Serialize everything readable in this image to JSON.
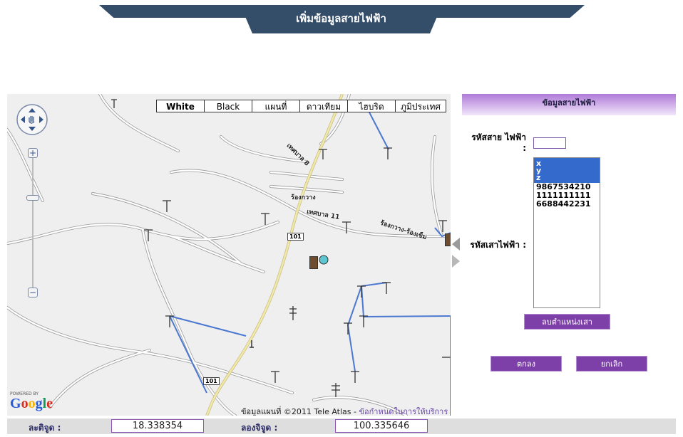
{
  "header": {
    "title": "เพิ่มข้อมูลสายไฟฟ้า"
  },
  "map": {
    "map_types": [
      "White",
      "Black",
      "แผนที่",
      "ดาวเทียม",
      "ไฮบริด",
      "ภูมิประเทศ"
    ],
    "active_map_type": "White",
    "powered_by": "POWERED BY",
    "google_logo": "Google",
    "copyright_prefix": "ข้อมูลแผนที่ ©2011 Tele Atlas - ",
    "terms_link": "ข้อกำหนดในการให้บริการ",
    "street_labels": [
      "เทศบาล 8",
      "ร้องกวาง",
      "เทศบาล 11",
      "ร้องกวาง-ร้องเข็ม"
    ],
    "route_shields": [
      "101",
      "101"
    ],
    "colors": {
      "background": "#efefef",
      "road": "#ffffff",
      "road_outline": "#9a9a9a",
      "highway": "#f3e9a6",
      "power_line": "#4b78d1"
    }
  },
  "panel": {
    "title": "ข้อมูลสายไฟฟ้า",
    "wire_code_label": "รหัสสาย ไฟฟ้า :",
    "wire_code_value": "",
    "pole_code_label": "รหัสเสาไฟฟ้า :",
    "pole_options": [
      {
        "text": "x",
        "selected": true
      },
      {
        "text": "y",
        "selected": true
      },
      {
        "text": "z",
        "selected": true
      },
      {
        "text": "9867534210",
        "selected": false
      },
      {
        "text": "1111111111",
        "selected": false
      },
      {
        "text": "6688442231",
        "selected": false
      }
    ],
    "delete_button": "ลบตำแหน่งเสา",
    "ok_button": "ตกลง",
    "cancel_button": "ยกเลิก"
  },
  "coords": {
    "lat_label": "ละติจูด :",
    "lat_value": "18.338354",
    "lng_label": "ลองจิจูด :",
    "lng_value": "100.335646"
  },
  "theme": {
    "banner": "#344e69",
    "accent": "#7d3fa8",
    "selection": "#336acb"
  }
}
